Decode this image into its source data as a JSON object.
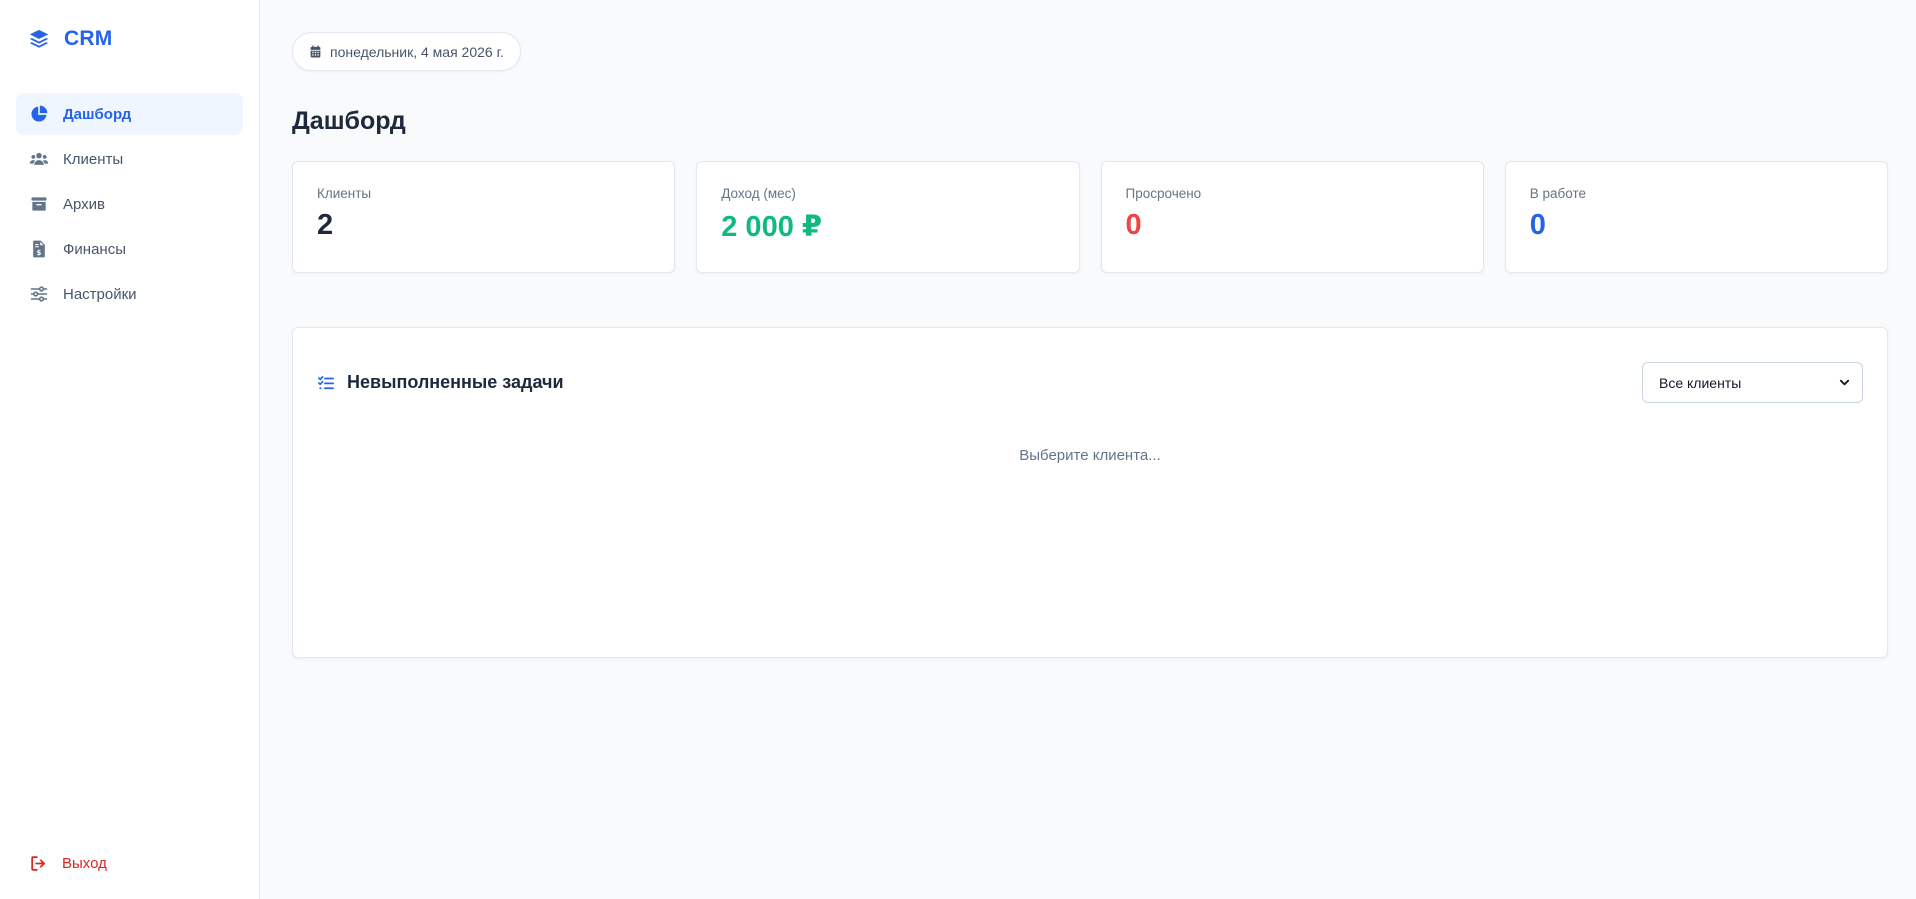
{
  "app": {
    "name": "CRM"
  },
  "sidebar": {
    "items": [
      {
        "label": "Дашборд",
        "icon": "chart-pie-icon",
        "active": true
      },
      {
        "label": "Клиенты",
        "icon": "users-icon",
        "active": false
      },
      {
        "label": "Архив",
        "icon": "archive-icon",
        "active": false
      },
      {
        "label": "Финансы",
        "icon": "invoice-icon",
        "active": false
      },
      {
        "label": "Настройки",
        "icon": "sliders-icon",
        "active": false
      }
    ],
    "logout_label": "Выход"
  },
  "header": {
    "date": "понедельник, 4 мая 2026 г.",
    "title": "Дашборд"
  },
  "stats": [
    {
      "label": "Клиенты",
      "value": "2",
      "color": "#1e293b"
    },
    {
      "label": "Доход (мес)",
      "value": "2 000 ₽",
      "color": "#10b981"
    },
    {
      "label": "Просрочено",
      "value": "0",
      "color": "#ef4444"
    },
    {
      "label": "В работе",
      "value": "0",
      "color": "#2563eb"
    }
  ],
  "tasks": {
    "title": "Невыполненные задачи",
    "filter_selected": "Все клиенты",
    "empty_message": "Выберите клиента..."
  },
  "colors": {
    "accent": "#2563eb",
    "danger": "#dc2626",
    "success": "#10b981"
  }
}
